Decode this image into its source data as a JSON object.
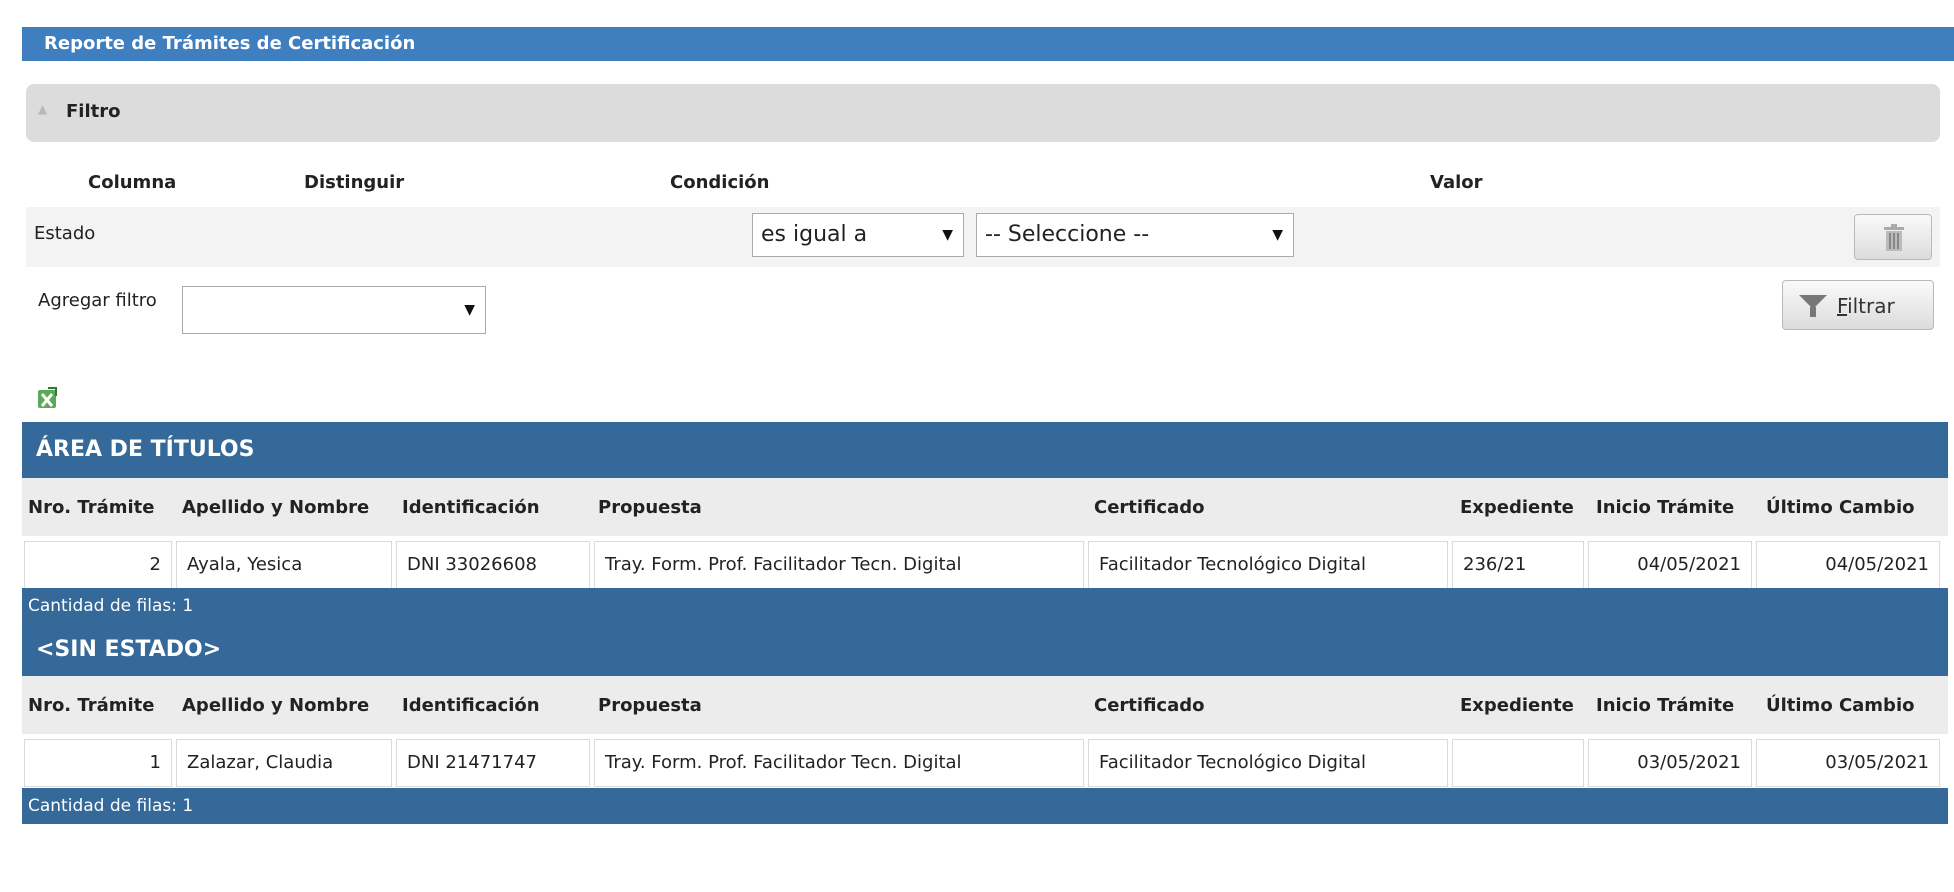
{
  "report_title": "Reporte de Trámites de Certificación",
  "filter": {
    "panel_label": "Filtro",
    "headers": {
      "columna": "Columna",
      "distinguir": "Distinguir",
      "condicion": "Condición",
      "valor": "Valor"
    },
    "row": {
      "column": "Estado",
      "condition_value": "es igual a",
      "value_select": "-- Seleccione --"
    },
    "add_filter_label": "Agregar filtro",
    "add_filter_value": "",
    "filtrar_first": "F",
    "filtrar_rest": "iltrar"
  },
  "icons": {
    "panel_toggle": "chevron-up-icon",
    "trash": "trash-icon",
    "filter": "funnel-icon",
    "export": "excel-export-icon"
  },
  "columns": [
    "Nro. Trámite",
    "Apellido y Nombre",
    "Identificación",
    "Propuesta",
    "Certificado",
    "Expediente",
    "Inicio Trámite",
    "Último Cambio"
  ],
  "groups": [
    {
      "title": "ÁREA DE TÍTULOS",
      "rows": [
        {
          "nro": "2",
          "nombre": "Ayala, Yesica",
          "id": "DNI 33026608",
          "propuesta": "Tray. Form. Prof. Facilitador Tecn. Digital",
          "certificado": "Facilitador Tecnológico Digital",
          "expediente": "236/21",
          "inicio": "04/05/2021",
          "ultimo": "04/05/2021"
        }
      ],
      "count": "Cantidad de filas: 1"
    },
    {
      "title": "<SIN ESTADO>",
      "rows": [
        {
          "nro": "1",
          "nombre": "Zalazar, Claudia",
          "id": "DNI 21471747",
          "propuesta": "Tray. Form. Prof. Facilitador Tecn. Digital",
          "certificado": "Facilitador Tecnológico Digital",
          "expediente": "",
          "inicio": "03/05/2021",
          "ultimo": "03/05/2021"
        }
      ],
      "count": "Cantidad de filas: 1"
    }
  ],
  "colors": {
    "title_bar": "#3f7fc0",
    "group_bar": "#35699a"
  }
}
